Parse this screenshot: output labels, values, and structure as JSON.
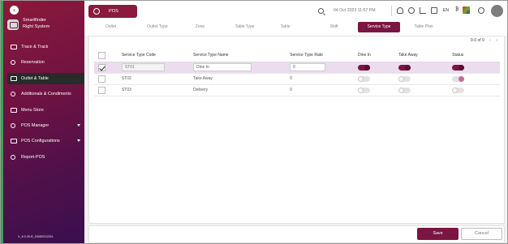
{
  "app": {
    "brand_line1": "Smartfinder",
    "brand_line2": "Right System",
    "version": "V_6.0.20.8_15052011331"
  },
  "sidebar": {
    "items": [
      {
        "label": "Trace & Track",
        "icon": "trace-icon",
        "active": false,
        "has_caret": false
      },
      {
        "label": "Reservation",
        "icon": "reservation-icon",
        "active": false,
        "has_caret": false
      },
      {
        "label": "Outlet & Table",
        "icon": "outlet-table-icon",
        "active": true,
        "has_caret": false
      },
      {
        "label": "Additionals & Condiments",
        "icon": "additionals-icon",
        "active": false,
        "has_caret": false
      },
      {
        "label": "Menu Store",
        "icon": "menu-store-icon",
        "active": false,
        "has_caret": false
      },
      {
        "label": "POS Manager",
        "icon": "pos-manager-icon",
        "active": false,
        "has_caret": true
      },
      {
        "label": "POS Configurations",
        "icon": "pos-config-icon",
        "active": false,
        "has_caret": true
      },
      {
        "label": "Report-POS",
        "icon": "report-icon",
        "active": false,
        "has_caret": false
      }
    ]
  },
  "header": {
    "module": "POS",
    "datetime": "04 Oct 2023  11:57 PM",
    "language": "EN",
    "currency_symbol": "₿"
  },
  "tabs": [
    {
      "label": "Outlet",
      "active": false
    },
    {
      "label": "Outlet Type",
      "active": false
    },
    {
      "label": "Zone",
      "active": false
    },
    {
      "label": "Table Type",
      "active": false
    },
    {
      "label": "Table",
      "active": false
    },
    {
      "label": "Shift",
      "active": false
    },
    {
      "label": "Service Type",
      "active": true
    },
    {
      "label": "Table Plan",
      "active": false
    }
  ],
  "pager": {
    "text": "0-0 of 0",
    "prev": "‹",
    "next": "›"
  },
  "table": {
    "headers": [
      "",
      "Service Type Code",
      "Service Type Name",
      "Service Type Rate",
      "Dine In",
      "Take Away",
      "Status"
    ],
    "rows": [
      {
        "checked": true,
        "code": "ST01",
        "name": "Dine In",
        "rate": "0",
        "dine_in": "on",
        "take_away": "on",
        "status": "on",
        "editing": true
      },
      {
        "checked": false,
        "code": "ST02",
        "name": "Take Away",
        "rate": "0",
        "dine_in": "off",
        "take_away": "off",
        "status": "pink",
        "editing": false
      },
      {
        "checked": false,
        "code": "ST03",
        "name": "Delivery",
        "rate": "0",
        "dine_in": "off",
        "take_away": "off",
        "status": "off",
        "editing": false
      }
    ]
  },
  "footer": {
    "save_label": "Save",
    "cancel_label": "Cancel"
  },
  "colors": {
    "accent": "#7b1542",
    "sidebar_top": "#8a1a3a",
    "sidebar_bottom": "#3a0f4e",
    "sidebar_edge": "#2ea84a"
  }
}
